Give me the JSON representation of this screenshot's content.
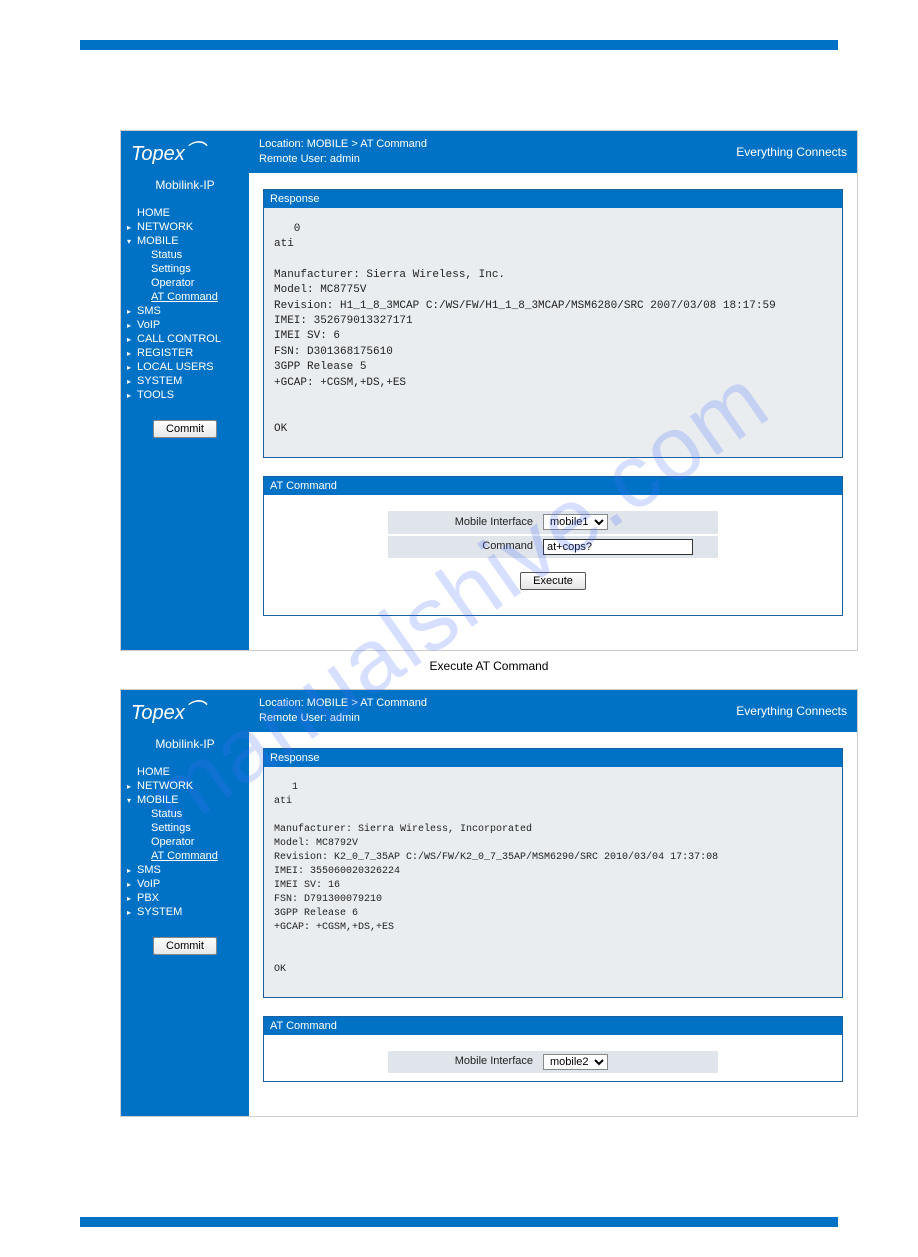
{
  "watermark": "manualshive.com",
  "brand": "Topex",
  "tagline": "Everything Connects",
  "caption": "Execute AT Command",
  "screens": [
    {
      "product": "Mobilink-IP",
      "location": "Location: MOBILE > AT Command",
      "remoteUser": "Remote User: admin",
      "nav": {
        "home": "HOME",
        "network": "NETWORK",
        "mobile": "MOBILE",
        "status": "Status",
        "settings": "Settings",
        "operator": "Operator",
        "atcmd": "AT Command",
        "sms": "SMS",
        "voip": "VoIP",
        "callctrl": "CALL CONTROL",
        "register": "REGISTER",
        "localusers": "LOCAL USERS",
        "system": "SYSTEM",
        "tools": "TOOLS"
      },
      "commit": "Commit",
      "responseTitle": "Response",
      "responseBody": "   0\nati\n\nManufacturer: Sierra Wireless, Inc.\nModel: MC8775V\nRevision: H1_1_8_3MCAP C:/WS/FW/H1_1_8_3MCAP/MSM6280/SRC 2007/03/08 18:17:59\nIMEI: 352679013327171\nIMEI SV: 6\nFSN: D301368175610\n3GPP Release 5\n+GCAP: +CGSM,+DS,+ES\n\n\nOK",
      "atTitle": "AT Command",
      "form": {
        "ifaceLabel": "Mobile Interface",
        "ifaceValue": "mobile1",
        "cmdLabel": "Command",
        "cmdValue": "at+cops?"
      },
      "execute": "Execute"
    },
    {
      "product": "Mobilink-IP",
      "location": "Location: MOBILE > AT Command",
      "remoteUser": "Remote User: admin",
      "nav": {
        "home": "HOME",
        "network": "NETWORK",
        "mobile": "MOBILE",
        "status": "Status",
        "settings": "Settings",
        "operator": "Operator",
        "atcmd": "AT Command",
        "sms": "SMS",
        "voip": "VoIP",
        "pbx": "PBX",
        "system": "SYSTEM"
      },
      "commit": "Commit",
      "responseTitle": "Response",
      "responseBody": "   1\nati\n\nManufacturer: Sierra Wireless, Incorporated\nModel: MC8792V\nRevision: K2_0_7_35AP C:/WS/FW/K2_0_7_35AP/MSM6290/SRC 2010/03/04 17:37:08\nIMEI: 355060020326224\nIMEI SV: 16\nFSN: D791300079210\n3GPP Release 6\n+GCAP: +CGSM,+DS,+ES\n\n\nOK",
      "atTitle": "AT Command",
      "form": {
        "ifaceLabel": "Mobile Interface",
        "ifaceValue": "mobile2"
      }
    }
  ]
}
